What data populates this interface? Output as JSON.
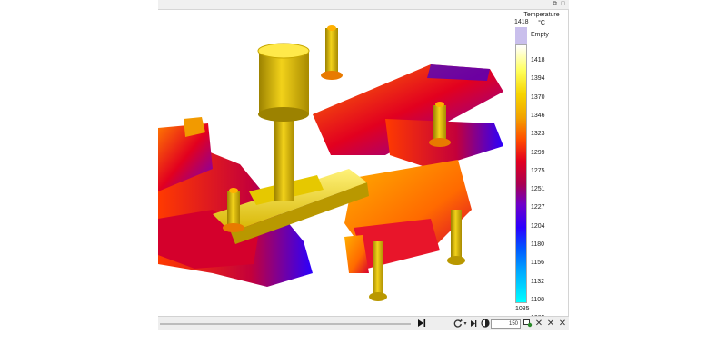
{
  "window": {
    "restore_label": "⧉",
    "close_label": "□"
  },
  "legend": {
    "title": "Temperature\n°C",
    "top_value": "1418",
    "empty_label": "Empty",
    "ticks": [
      "1418",
      "1394",
      "1370",
      "1346",
      "1323",
      "1299",
      "1275",
      "1251",
      "1227",
      "1204",
      "1180",
      "1156",
      "1132",
      "1108",
      "1085"
    ],
    "bottom_value": "1085",
    "colors": {
      "empty": "#c9bfec",
      "hot": "#ffffff",
      "cold": "#00ffff"
    }
  },
  "toolbar": {
    "speed_value": "150",
    "icons": [
      "skip-to-end-icon",
      "refresh-icon",
      "dropdown-arrow-icon",
      "step-forward-icon",
      "contrast-icon",
      "record-icon",
      "close-icon",
      "close-icon",
      "close-icon"
    ]
  }
}
